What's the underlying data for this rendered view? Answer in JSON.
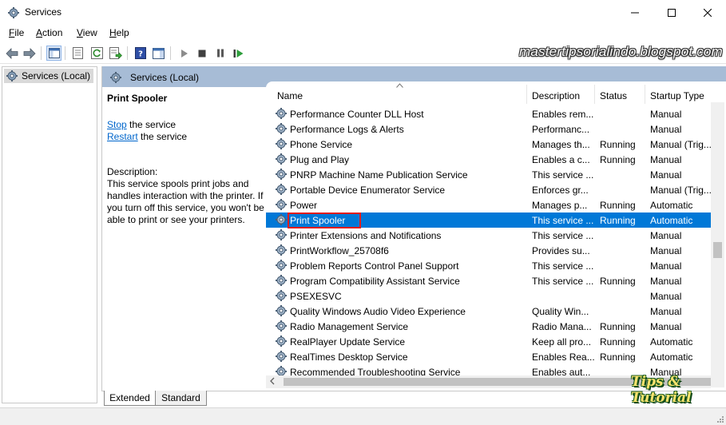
{
  "window": {
    "title": "Services"
  },
  "menu": {
    "items": [
      {
        "first": "F",
        "rest": "ile"
      },
      {
        "first": "A",
        "rest": "ction"
      },
      {
        "first": "V",
        "rest": "iew"
      },
      {
        "first": "H",
        "rest": "elp"
      }
    ]
  },
  "watermark": "mastertipsorialindo.blogspot.com",
  "tree": {
    "root": "Services (Local)"
  },
  "panel": {
    "title": "Services (Local)"
  },
  "details": {
    "service_name": "Print Spooler",
    "stop_link": "Stop",
    "stop_rest": " the service",
    "restart_link": "Restart",
    "restart_rest": " the service",
    "description_label": "Description:",
    "description_text": "This service spools print jobs and handles interaction with the printer. If you turn off this service, you won't be able to print or see your printers."
  },
  "columns": {
    "name": "Name",
    "description": "Description",
    "status": "Status",
    "startup_type": "Startup Type"
  },
  "services": [
    {
      "name": "Performance Counter DLL Host",
      "description": "Enables rem...",
      "status": "",
      "startup": "Manual"
    },
    {
      "name": "Performance Logs & Alerts",
      "description": "Performanc...",
      "status": "",
      "startup": "Manual"
    },
    {
      "name": "Phone Service",
      "description": "Manages th...",
      "status": "Running",
      "startup": "Manual (Trig..."
    },
    {
      "name": "Plug and Play",
      "description": "Enables a c...",
      "status": "Running",
      "startup": "Manual"
    },
    {
      "name": "PNRP Machine Name Publication Service",
      "description": "This service ...",
      "status": "",
      "startup": "Manual"
    },
    {
      "name": "Portable Device Enumerator Service",
      "description": "Enforces gr...",
      "status": "",
      "startup": "Manual (Trig..."
    },
    {
      "name": "Power",
      "description": "Manages p...",
      "status": "Running",
      "startup": "Automatic"
    },
    {
      "name": "Print Spooler",
      "description": "This service ...",
      "status": "Running",
      "startup": "Automatic"
    },
    {
      "name": "Printer Extensions and Notifications",
      "description": "This service ...",
      "status": "",
      "startup": "Manual"
    },
    {
      "name": "PrintWorkflow_25708f6",
      "description": "Provides su...",
      "status": "",
      "startup": "Manual"
    },
    {
      "name": "Problem Reports Control Panel Support",
      "description": "This service ...",
      "status": "",
      "startup": "Manual"
    },
    {
      "name": "Program Compatibility Assistant Service",
      "description": "This service ...",
      "status": "Running",
      "startup": "Manual"
    },
    {
      "name": "PSEXESVC",
      "description": "",
      "status": "",
      "startup": "Manual"
    },
    {
      "name": "Quality Windows Audio Video Experience",
      "description": "Quality Win...",
      "status": "",
      "startup": "Manual"
    },
    {
      "name": "Radio Management Service",
      "description": "Radio Mana...",
      "status": "Running",
      "startup": "Manual"
    },
    {
      "name": "RealPlayer Update Service",
      "description": "Keep all pro...",
      "status": "Running",
      "startup": "Automatic"
    },
    {
      "name": "RealTimes Desktop Service",
      "description": "Enables Rea...",
      "status": "Running",
      "startup": "Automatic"
    },
    {
      "name": "Recommended Troubleshooting Service",
      "description": "Enables aut...",
      "status": "",
      "startup": "Manual"
    }
  ],
  "selected_service": "Print Spooler",
  "tabs": {
    "extended": "Extended",
    "standard": "Standard"
  },
  "logo_text": "Tips & Tutorial",
  "colors": {
    "selection": "#0078d7",
    "panel_header": "#a7bcd6",
    "highlight_box": "#e21d1d",
    "link": "#0066cc"
  }
}
